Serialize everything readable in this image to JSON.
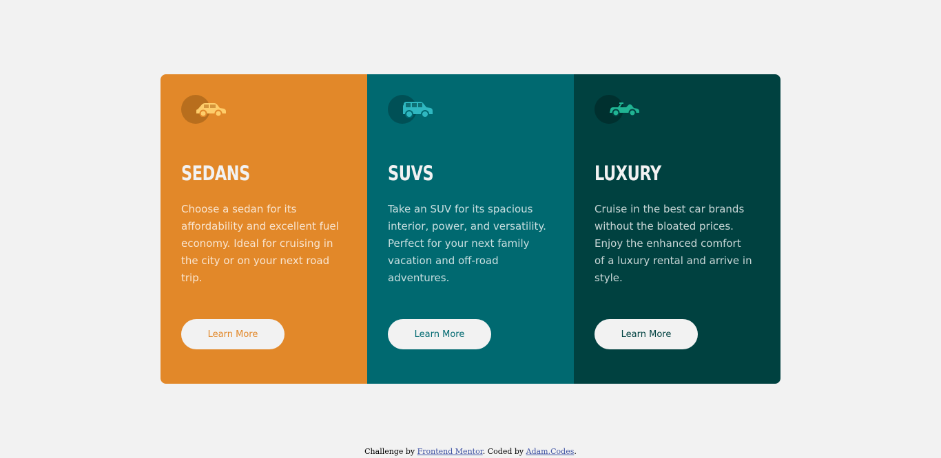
{
  "cards": [
    {
      "title": "Sedans",
      "description": "Choose a sedan for its affordability and excellent fuel economy. Ideal for cruising in the city or on your next road trip.",
      "button_label": "Learn More",
      "icon": "sedan-car-icon",
      "color": "#e28829"
    },
    {
      "title": "SUVs",
      "description": "Take an SUV for its spacious interior, power, and versatility. Perfect for your next family vacation and off-road adventures.",
      "button_label": "Learn More",
      "icon": "suv-car-icon",
      "color": "#006970"
    },
    {
      "title": "Luxury",
      "description": "Cruise in the best car brands without the bloated prices. Enjoy the enhanced comfort of a luxury rental and arrive in style.",
      "button_label": "Learn More",
      "icon": "luxury-car-icon",
      "color": "#004140"
    }
  ],
  "footer": {
    "prefix": "Challenge by",
    "link1": "Frontend Mentor",
    "middle": ". Coded by",
    "link2": "Adam.Codes",
    "suffix": "."
  }
}
